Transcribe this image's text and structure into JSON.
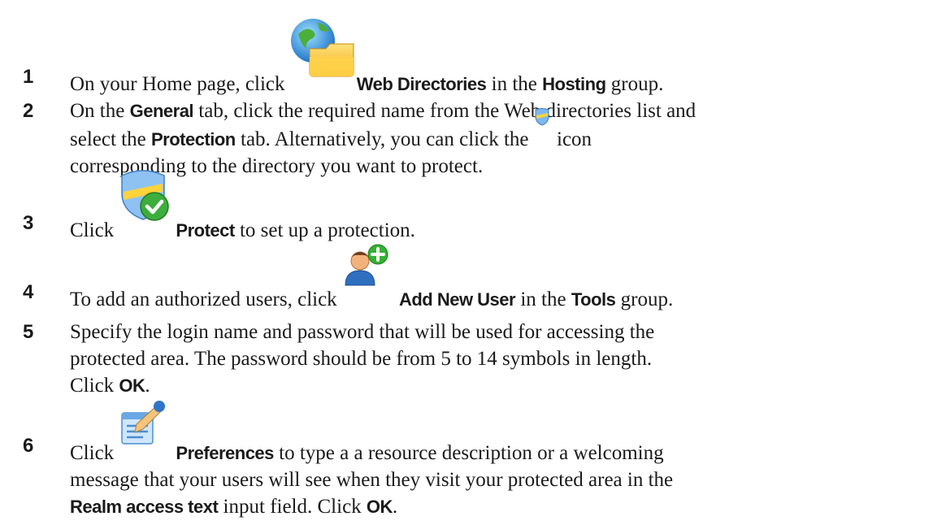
{
  "steps": [
    {
      "number": "1",
      "text_a": "On your Home page, click ",
      "icon": "web-directories-icon",
      "ui_a": "Web Directories",
      "text_b": " in the ",
      "ui_b": "Hosting",
      "text_c": " group."
    },
    {
      "number": "2",
      "text_a": "On the ",
      "ui_a": "General",
      "text_b": " tab, click the required name from the Web directories list and",
      "text_c": "select the ",
      "ui_b": "Protection",
      "text_d": " tab. Alternatively, you can click the ",
      "icon": "protection-shield-icon",
      "text_e": " icon",
      "text_f": "corresponding to the directory you want to protect."
    },
    {
      "number": "3",
      "text_a": "Click ",
      "icon": "protect-icon",
      "ui_a": "Protect",
      "text_b": " to set up a protection."
    },
    {
      "number": "4",
      "text_a": "To add an authorized users, click ",
      "icon": "add-new-user-icon",
      "ui_a": "Add New User",
      "text_b": " in the ",
      "ui_b": "Tools",
      "text_c": " group."
    },
    {
      "number": "5",
      "text_a": "Specify the login name and password that will be used for accessing the",
      "text_b": "protected area. The password should be from 5 to 14 symbols in length.",
      "text_c": "Click ",
      "ui_a": "OK",
      "text_d": "."
    },
    {
      "number": "6",
      "text_a": "Click ",
      "icon": "preferences-icon",
      "ui_a": "Preferences",
      "text_b": " to type a a resource description or a welcoming",
      "text_c": "message that your users will see when they visit your protected area in the",
      "ui_b": "Realm access text",
      "text_d": " input field. Click ",
      "ui_c": "OK",
      "text_e": "."
    }
  ]
}
